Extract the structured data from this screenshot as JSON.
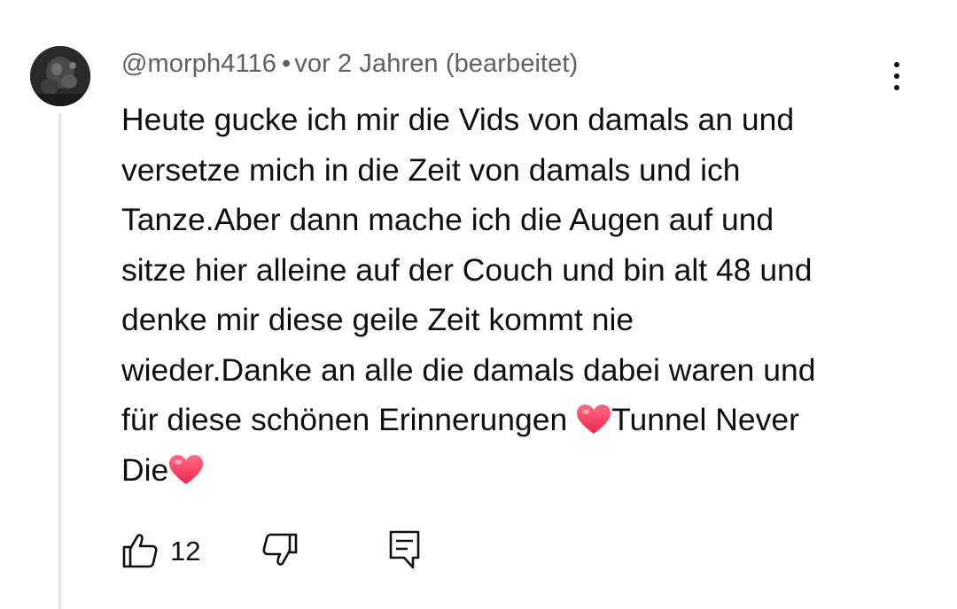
{
  "comment": {
    "author": "@morph4116",
    "separator": "•",
    "timestamp": "vor 2 Jahren (bearbeitet)",
    "text_lines": [
      "Heute gucke ich mir die Vids von damals an und",
      "versetze mich in die Zeit von damals und ich",
      "Tanze.Aber dann mache ich die Augen auf und",
      "sitze hier alleine auf der Couch und bin alt 48 und",
      "denke mir diese geile Zeit kommt nie",
      "wieder.Danke an alle die damals dabei waren und",
      "für diese schönen Erinnerungen ",
      "Tunnel Never",
      "Die"
    ],
    "like_count": "12"
  },
  "icons": {
    "avatar": "avatar-image",
    "menu": "more-vertical-icon",
    "like": "thumbs-up-icon",
    "dislike": "thumbs-down-icon",
    "reply": "comment-reply-icon",
    "emoji": "red-heart-emoji"
  },
  "colors": {
    "text": "#0f0f0f",
    "meta": "#606060",
    "thread_line": "#e5e5e5",
    "heart": "#ff3f63"
  }
}
